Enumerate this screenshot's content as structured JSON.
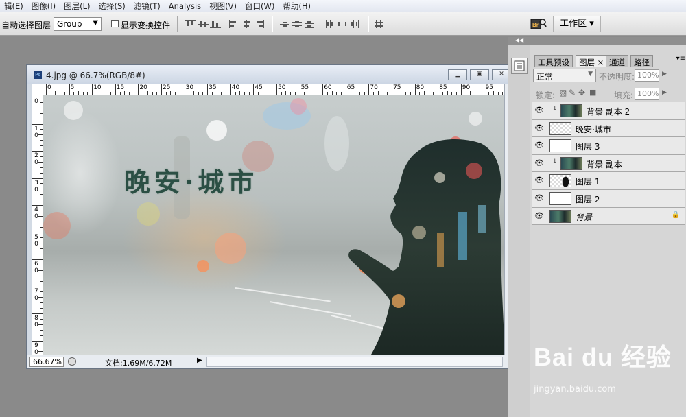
{
  "menu": [
    "辑(E)",
    "图像(I)",
    "图层(L)",
    "选择(S)",
    "滤镜(T)",
    "Analysis",
    "视图(V)",
    "窗口(W)",
    "帮助(H)"
  ],
  "options": {
    "auto_select_label": "自动选择图层",
    "auto_select_value": "Group",
    "show_transform_label": "显示变换控件",
    "workspace_label": "工作区 ▾"
  },
  "document": {
    "title": "4.jpg @ 66.7%(RGB/8#)",
    "ruler_top": [
      "0",
      "5",
      "10",
      "15",
      "20",
      "25",
      "30",
      "35",
      "40",
      "45",
      "50",
      "55",
      "60",
      "65",
      "70",
      "75",
      "80",
      "85",
      "90",
      "95"
    ],
    "ruler_left": [
      "0",
      "1\n0",
      "2\n0",
      "3\n0",
      "4\n0",
      "5\n0",
      "6\n0",
      "7\n0",
      "8\n0",
      "9\n0"
    ],
    "canvas_text": "晚安·城市",
    "zoom": "66.67%",
    "doc_info": "文档:1.69M/6.72M"
  },
  "panel": {
    "tabs": [
      "工具预设",
      "图层 ×",
      "通道",
      "路径"
    ],
    "blend_mode": "正常",
    "opacity_label": "不透明度:",
    "opacity_value": "100%",
    "lock_label": "锁定:",
    "fill_label": "填充:",
    "fill_value": "100%",
    "layers": [
      {
        "name": "背景 副本 2",
        "thumb": "city",
        "clipped": true
      },
      {
        "name": "晚安·城市",
        "thumb": "checker",
        "clipped": false
      },
      {
        "name": "图层 3",
        "thumb": "white",
        "clipped": false
      },
      {
        "name": "背景 副本",
        "thumb": "city",
        "clipped": true
      },
      {
        "name": "图层 1",
        "thumb": "checker-sil",
        "clipped": false
      },
      {
        "name": "图层 2",
        "thumb": "white",
        "clipped": false
      },
      {
        "name": "背景",
        "thumb": "city",
        "clipped": false,
        "locked": true
      }
    ]
  },
  "watermark": {
    "brand": "Bai du 经验",
    "url": "jingyan.baidu.com"
  }
}
